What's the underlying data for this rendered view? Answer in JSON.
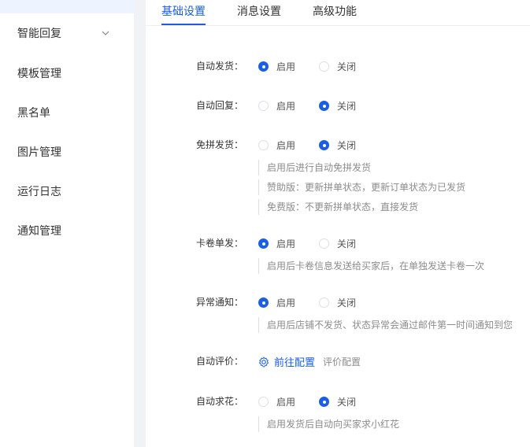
{
  "sidebar": {
    "items": [
      {
        "label": "智能回复",
        "has_chevron": true
      },
      {
        "label": "模板管理"
      },
      {
        "label": "黑名单"
      },
      {
        "label": "图片管理"
      },
      {
        "label": "运行日志"
      },
      {
        "label": "通知管理"
      }
    ]
  },
  "tabs": [
    {
      "label": "基础设置",
      "active": true
    },
    {
      "label": "消息设置",
      "active": false
    },
    {
      "label": "高级功能",
      "active": false
    }
  ],
  "options": {
    "enable": "启用",
    "disable": "关闭"
  },
  "settings": {
    "auto_ship": {
      "label": "自动发货：",
      "value": "启用"
    },
    "auto_reply": {
      "label": "自动回复：",
      "value": "关闭"
    },
    "free_group_ship": {
      "label": "免拼发货：",
      "value": "关闭",
      "hints": [
        "启用后进行自动免拼发货",
        "赞助版：更新拼单状态，更新订单状态为已发货",
        "免费版：不更新拼单状态，直接发货"
      ]
    },
    "card_ship": {
      "label": "卡卷单发：",
      "value": "启用",
      "hints": [
        "启用后卡卷信息发送给买家后，在单独发送卡卷一次"
      ]
    },
    "abnormal_notice": {
      "label": "异常通知：",
      "value": "启用",
      "hints": [
        "启用后店铺不发货、状态异常会通过邮件第一时间通知到您"
      ]
    },
    "auto_review": {
      "label": "自动评价：",
      "link": "前往配置",
      "note": "评价配置"
    },
    "auto_flower": {
      "label": "自动求花：",
      "value": "关闭",
      "hints": [
        "启用发货后自动向买家求小红花"
      ]
    }
  },
  "colors": {
    "accent": "#1a5ee6",
    "muted": "#8c8c8c"
  }
}
